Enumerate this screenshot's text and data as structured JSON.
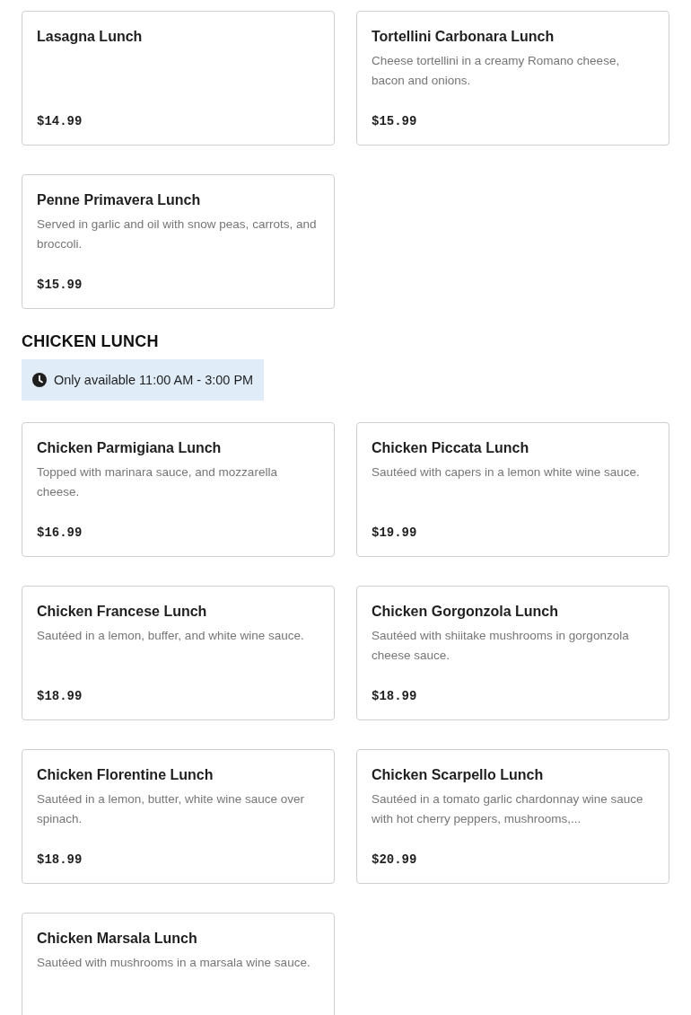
{
  "menu_sections": [
    {
      "items": [
        {
          "name": "Lasagna Lunch",
          "price": "$14.99"
        },
        {
          "name": "Tortellini Carbonara Lunch",
          "description": "Cheese tortellini in a creamy Romano cheese, bacon and onions.",
          "price": "$15.99"
        },
        {
          "name": "Penne Primavera Lunch",
          "description": "Served in garlic and oil with snow peas, carrots, and broccoli.",
          "price": "$15.99"
        }
      ]
    },
    {
      "heading": "CHICKEN LUNCH",
      "availability_notice": "Only available 11:00 AM - 3:00 PM",
      "items": [
        {
          "name": "Chicken Parmigiana Lunch",
          "description": "Topped with marinara sauce, and mozzarella cheese.",
          "price": "$16.99"
        },
        {
          "name": "Chicken Piccata Lunch",
          "description": "Sautéed with capers in a lemon white wine sauce.",
          "price": "$19.99"
        },
        {
          "name": "Chicken Francese Lunch",
          "description": "Sautéed in a lemon, buffer, and white wine sauce.",
          "price": "$18.99"
        },
        {
          "name": "Chicken Gorgonzola Lunch",
          "description": "Sautéed with shiitake mushrooms in gorgonzola cheese sauce.",
          "price": "$18.99"
        },
        {
          "name": "Chicken Florentine Lunch",
          "description": "Sautéed in a lemon, butter, white wine sauce over spinach.",
          "price": "$18.99"
        },
        {
          "name": "Chicken Scarpello Lunch",
          "description": "Sautéed in a tomato garlic chardonnay wine sauce with hot cherry peppers, mushrooms,...",
          "price": "$20.99"
        },
        {
          "name": "Chicken Marsala Lunch",
          "description": "Sautéed with mushrooms in a marsala wine sauce."
        }
      ]
    }
  ]
}
